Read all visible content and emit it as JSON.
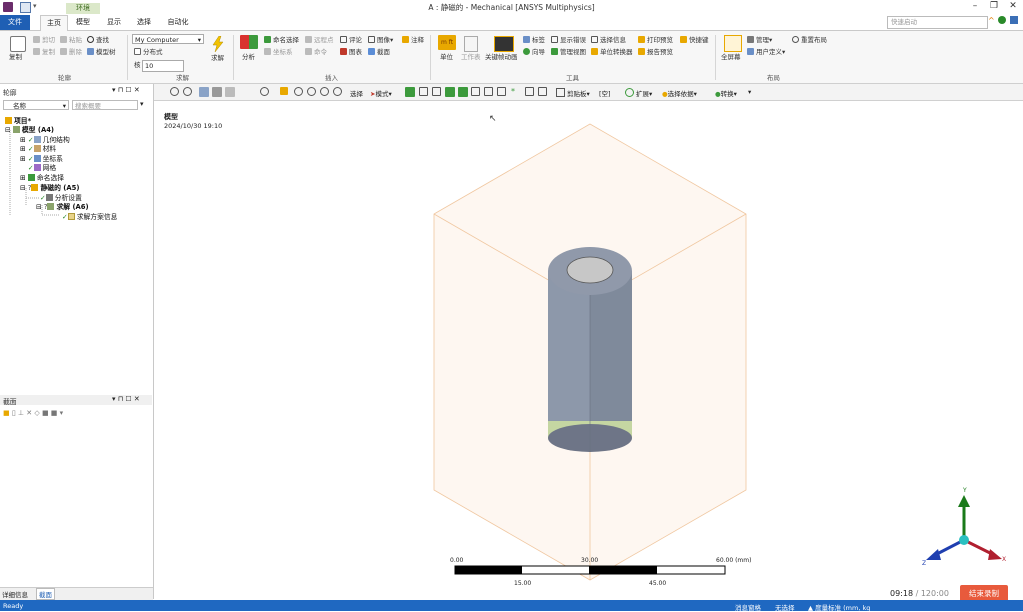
{
  "window": {
    "title": "A : 静磁的 - Mechanical [ANSYS Multiphysics]",
    "context_tab": "环境"
  },
  "tabs": [
    "文件",
    "主页",
    "模型",
    "显示",
    "选择",
    "自动化"
  ],
  "quick_search_placeholder": "快速启动",
  "ribbon": {
    "outline_group": {
      "label": "轮廓",
      "copy": "复制",
      "cut": "剪切",
      "paste": "粘贴",
      "delete": "删除",
      "find": "查找",
      "tree": "模型树"
    },
    "solve_group": {
      "label": "求解",
      "target": "My Computer",
      "distributed": "分布式",
      "cores_label": "核",
      "cores_value": "10",
      "solve": "求解"
    },
    "insert_group": {
      "label": "插入",
      "analysis": "分析",
      "named_selection": "命名选择",
      "remote_point": "远程点",
      "coord_system": "坐标系",
      "commands": "命令",
      "comment": "评论",
      "chart": "图表",
      "images": "图像",
      "section": "截面",
      "annotation": "注释"
    },
    "tools_group": {
      "label": "工具",
      "units": "单位",
      "worksheet": "工作表",
      "key_frame": "关键帧动画",
      "tags": "标签",
      "wizard": "向导",
      "show_errors": "显示错误",
      "manage_views": "管理视图",
      "selection_info": "选择信息",
      "unit_converter": "单位转换器",
      "print_preview": "打印预览",
      "report_preview": "报告预览",
      "shortcuts": "快捷键"
    },
    "layout_group": {
      "label": "布局",
      "fullscreen": "全屏幕",
      "manage": "管理",
      "user_defined": "用户定义",
      "reset_layout": "重置布局"
    }
  },
  "toolbar": {
    "select": "选择",
    "mode": "模式",
    "clipboard": "剪贴板",
    "empty": "[空]",
    "extend": "扩展",
    "select_by": "选择依据",
    "convert": "转换"
  },
  "outline": {
    "title": "轮廓",
    "name_label": "名称",
    "search_placeholder": "搜索概要",
    "project": "项目*",
    "model": "模型 (A4)",
    "nodes": [
      "几何结构",
      "材料",
      "坐标系",
      "网格",
      "命名选择"
    ],
    "analysis": "静磁的 (A5)",
    "analysis_settings": "分析设置",
    "solution": "求解 (A6)",
    "solution_info": "求解方案信息"
  },
  "section_panel": {
    "title": "截面"
  },
  "bottom_tabs": [
    "详细信息",
    "截面"
  ],
  "viewport": {
    "model_label": "模型",
    "timestamp": "2024/10/30 19:10",
    "scale_top": [
      "0.00",
      "30.00",
      "60.00 (mm)"
    ],
    "scale_bottom": [
      "15.00",
      "45.00"
    ],
    "axis_labels": [
      "Y",
      "Z",
      "X"
    ]
  },
  "recording": {
    "elapsed": "09:18",
    "separator": " / ",
    "total": "120:00",
    "stop_label": "结束录制"
  },
  "status": {
    "ready": "Ready",
    "messages": "消息窗格",
    "no_selection": "无选择",
    "units": "▲ 度量标准 (mm, kg"
  },
  "colors": {
    "file_tab": "#1f5fb4",
    "status_bar": "#1f68c1",
    "record_button": "#e85a3c",
    "cylinder": "#7f8a9b",
    "box_edges": "#f0c7a0"
  }
}
